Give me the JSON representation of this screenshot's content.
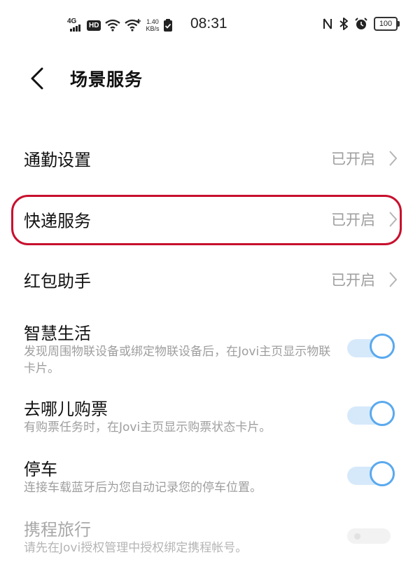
{
  "status_bar": {
    "network": "4G",
    "hd": "HD",
    "speed_value": "1.40",
    "speed_unit": "KB/s",
    "time": "08:31",
    "battery": "100"
  },
  "header": {
    "title": "场景服务"
  },
  "nav_items": [
    {
      "label": "通勤设置",
      "value": "已开启"
    },
    {
      "label": "快递服务",
      "value": "已开启"
    },
    {
      "label": "红包助手",
      "value": "已开启"
    }
  ],
  "toggle_items": [
    {
      "title": "智慧生活",
      "desc": "发现周围物联设备或绑定物联设备后，在Jovi主页显示物联卡片。",
      "enabled": true,
      "state": "on"
    },
    {
      "title": "去哪儿购票",
      "desc": "有购票任务时，在Jovi主页显示购票状态卡片。",
      "enabled": true,
      "state": "on"
    },
    {
      "title": "停车",
      "desc": "连接车载蓝牙后为您自动记录您的停车位置。",
      "enabled": true,
      "state": "on"
    },
    {
      "title": "携程旅行",
      "desc": "请先在Jovi授权管理中授权绑定携程帐号。",
      "enabled": false,
      "state": "off"
    }
  ],
  "colors": {
    "highlight": "#c8102e",
    "switch_on": "#5aa9ee",
    "value_text": "#9e9e9e"
  }
}
